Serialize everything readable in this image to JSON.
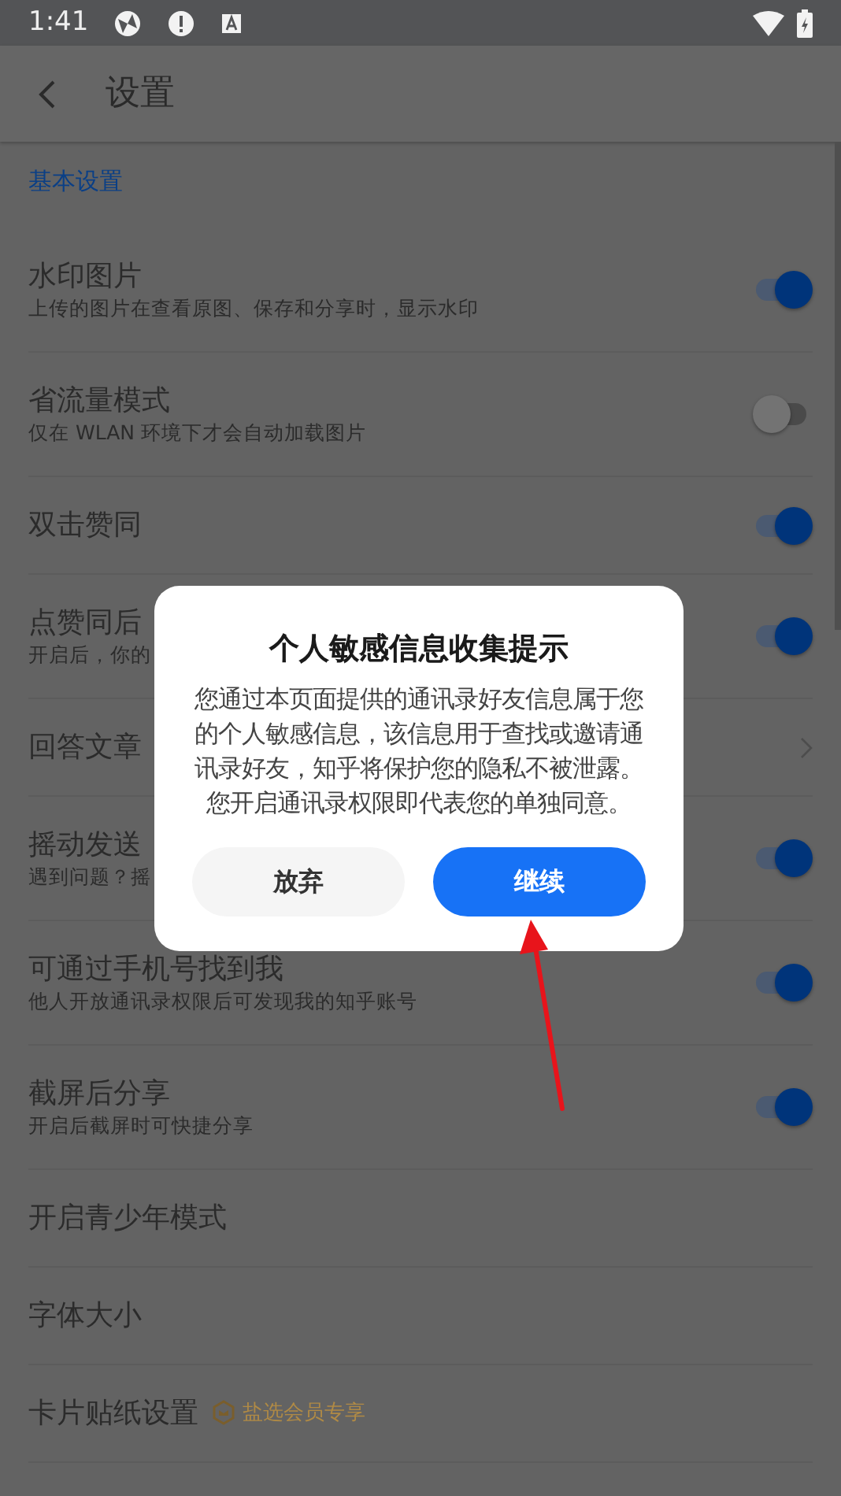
{
  "status_bar": {
    "time": "1:41"
  },
  "header": {
    "title": "设置"
  },
  "section": {
    "title": "基本设置"
  },
  "settings": [
    {
      "kind": "toggle",
      "title": "水印图片",
      "subtitle": "上传的图片在查看原图、保存和分享时，显示水印",
      "on": true
    },
    {
      "kind": "toggle",
      "title": "省流量模式",
      "subtitle": "仅在 WLAN 环境下才会自动加载图片",
      "on": false
    },
    {
      "kind": "toggle",
      "title": "双击赞同",
      "on": true
    },
    {
      "kind": "toggle",
      "title": "点赞同后",
      "subtitle": "开启后，你的",
      "on": true
    },
    {
      "kind": "link",
      "title": "回答文章"
    },
    {
      "kind": "toggle",
      "title": "摇动发送",
      "subtitle": "遇到问题？摇",
      "on": true
    },
    {
      "kind": "toggle",
      "title": "可通过手机号找到我",
      "subtitle": "他人开放通讯录权限后可发现我的知乎账号",
      "on": true
    },
    {
      "kind": "toggle",
      "title": "截屏后分享",
      "subtitle": "开启后截屏时可快捷分享",
      "on": true
    },
    {
      "kind": "plain",
      "title": "开启青少年模式"
    },
    {
      "kind": "plain",
      "title": "字体大小"
    },
    {
      "kind": "badge",
      "title": "卡片贴纸设置",
      "badge": "盐选会员专享"
    }
  ],
  "dialog": {
    "title": "个人敏感信息收集提示",
    "message": "您通过本页面提供的通讯录好友信息属于您的个人敏感信息，该信息用于查找或邀请通讯录好友，知乎将保护您的隐私不被泄露。您开启通讯录权限即代表您的单独同意。",
    "buttons": [
      {
        "label": "放弃",
        "kind": "secondary"
      },
      {
        "label": "继续",
        "kind": "primary"
      }
    ]
  }
}
